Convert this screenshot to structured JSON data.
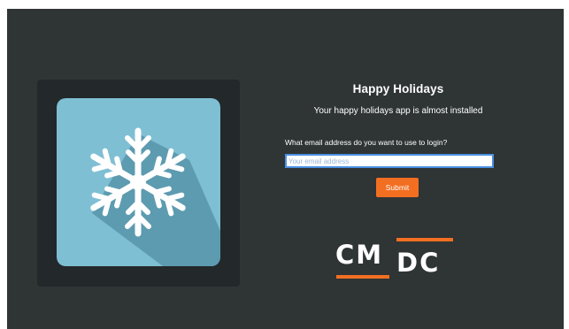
{
  "app": {
    "title": "Happy Holidays",
    "subtitle": "Your happy holidays app is almost installed",
    "icon": "snowflake-icon"
  },
  "form": {
    "email_label": "What email address do you want to use to login?",
    "email_placeholder": "Your email address",
    "email_value": "",
    "submit_label": "Submit"
  },
  "brand": {
    "logo_left": "CM",
    "logo_right": "DC",
    "accent": "#f26f21"
  },
  "colors": {
    "background": "#2f3435",
    "card": "#23282a",
    "tile": "#7fbfd4",
    "input_border": "#4a90e2"
  }
}
